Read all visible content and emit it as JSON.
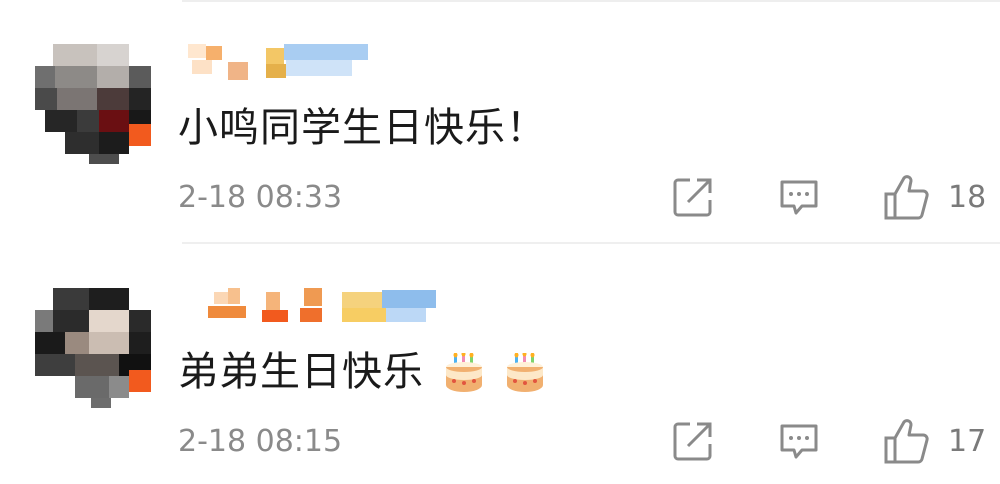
{
  "comments": [
    {
      "text": "小鸣同学生日快乐！",
      "emojis": [],
      "timestamp": "2-18 08:33",
      "likes": "18"
    },
    {
      "text": "弟弟生日快乐",
      "emojis": [
        "birthday-cake",
        "birthday-cake"
      ],
      "timestamp": "2-18 08:15",
      "likes": "17"
    }
  ],
  "icons": {
    "share": "share-icon",
    "reply": "comment-icon",
    "like": "thumbs-up-icon"
  },
  "colors": {
    "text": "#1a1a1a",
    "meta": "#8a8a8a",
    "icon": "#8a8a8a"
  }
}
